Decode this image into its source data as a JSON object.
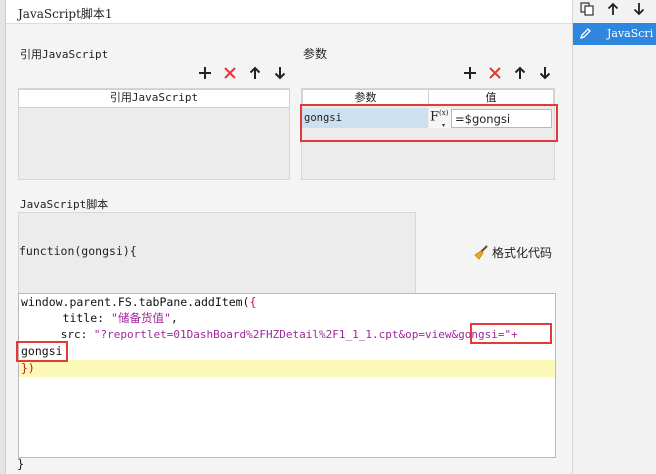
{
  "window": {
    "title": "JavaScript脚本1"
  },
  "referenced_js": {
    "label": "引用JavaScript",
    "column_header": "引用JavaScript"
  },
  "params": {
    "label": "参数",
    "columns": [
      "参数",
      "值"
    ],
    "rows": [
      {
        "name": "gongsi",
        "fx_label": "F(x)",
        "value": "=$gongsi"
      }
    ]
  },
  "script": {
    "label": "JavaScript脚本",
    "signature": "function(gongsi){",
    "format_label": "格式化代码",
    "code": {
      "l1a": "window.parent.FS.tabPane.addItem(",
      "l1b": "{",
      "l2a": "      title: ",
      "l2b": "\"储备货值\"",
      "l2c": ",",
      "l3a": "      src: ",
      "l3b": "\"?reportlet=01DashBoard%2FHZDetail%2F1_1_1.cpt&op=view&gongsi=\"",
      "l3c": "+",
      "l4": "gongsi",
      "l5": "})"
    },
    "closing_brace": "}"
  },
  "sidebar": {
    "items": [
      {
        "label": "JavaScri"
      }
    ]
  },
  "colors": {
    "accent": "#2e86de",
    "highlight_row": "#cde0ef",
    "current_line": "#fbf8b8",
    "annotation": "#e53935",
    "delete": "#e53935"
  }
}
